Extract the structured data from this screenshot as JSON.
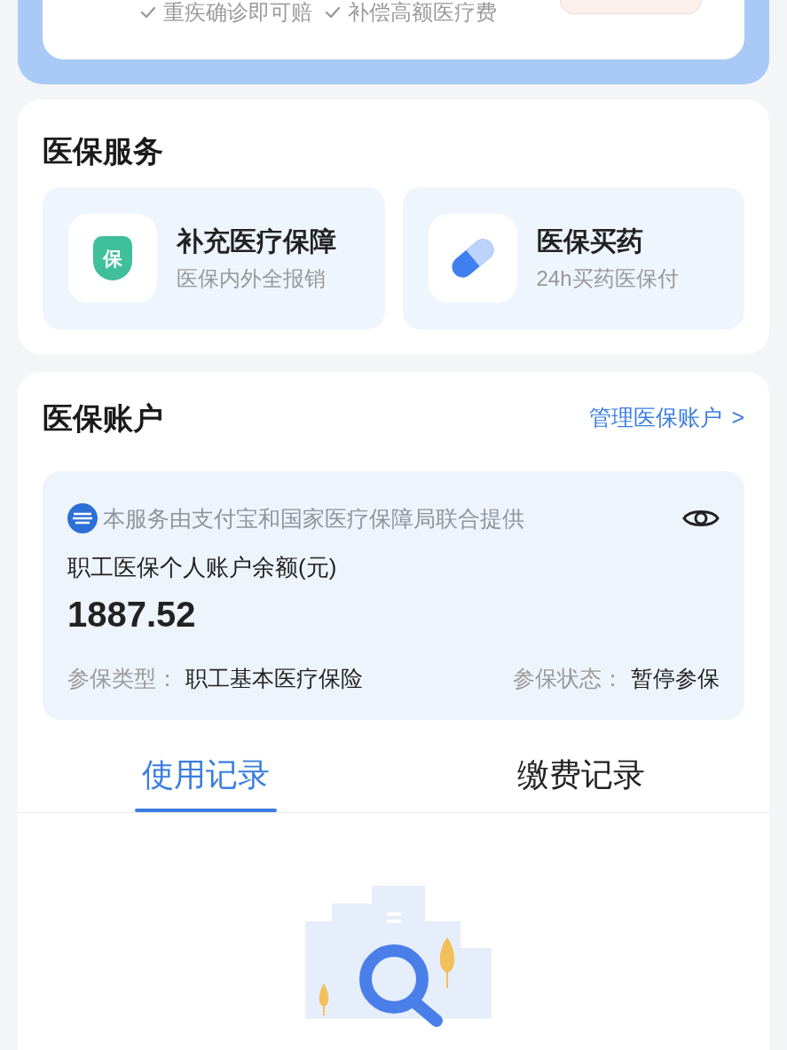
{
  "promo_card": {
    "features": [
      "重疾确诊即可赔",
      "补偿高额医疗费"
    ]
  },
  "services": {
    "title": "医保服务",
    "items": [
      {
        "kind": "shield",
        "title": "补充医疗保障",
        "subtitle": "医保内外全报销",
        "icon_text": "保"
      },
      {
        "kind": "pill",
        "title": "医保买药",
        "subtitle": "24h买药医保付"
      }
    ]
  },
  "account": {
    "title": "医保账户",
    "manage_link": "管理医保账户",
    "chevron": ">",
    "provider_note": "本服务由支付宝和国家医疗保障局联合提供",
    "balance_label": "职工医保个人账户余额(元)",
    "balance": "1887.52",
    "insurance_type_label": "参保类型：",
    "insurance_type": "职工基本医疗保险",
    "insurance_status_label": "参保状态：",
    "insurance_status": "暂停参保"
  },
  "tabs": [
    {
      "label": "使用记录",
      "selected": true
    },
    {
      "label": "缴费记录",
      "selected": false
    }
  ]
}
